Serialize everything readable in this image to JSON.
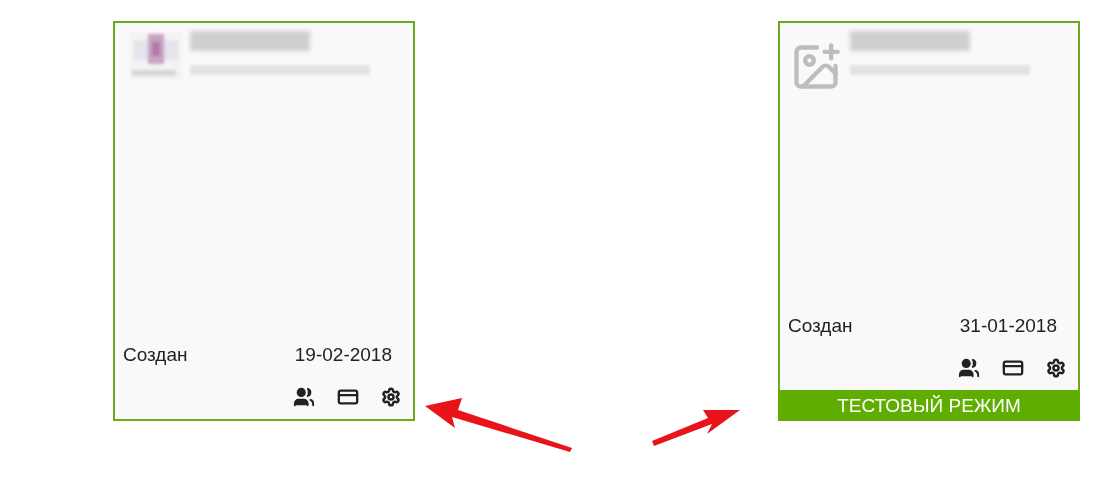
{
  "cards": [
    {
      "created_label": "Создан",
      "date": "19-02-2018"
    },
    {
      "logo": {
        "kind": "placeholder"
      },
      "created_label": "Создан",
      "date": "31-01-2018",
      "banner": "ТЕСТОВЫЙ РЕЖИМ"
    }
  ]
}
